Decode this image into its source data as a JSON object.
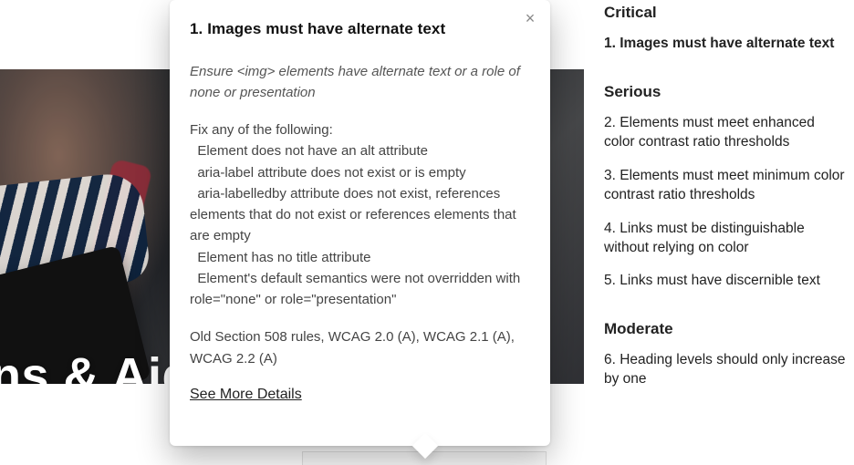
{
  "hero": {
    "headline_fragment": "ns & Aid"
  },
  "popup": {
    "title": "1. Images must have alternate text",
    "description": "Ensure <img> elements have alternate text or a role of none or presentation",
    "fix_text": "Fix any of the following:\n  Element does not have an alt attribute\n  aria-label attribute does not exist or is empty\n  aria-labelledby attribute does not exist, references elements that do not exist or references elements that are empty\n  Element has no title attribute\n  Element's default semantics were not overridden with role=\"none\" or role=\"presentation\"",
    "standards": "Old Section 508 rules, WCAG 2.0 (A), WCAG 2.1 (A), WCAG 2.2 (A)",
    "see_more_label": "See More Details",
    "close_label": "×"
  },
  "sidebar": {
    "sections": {
      "critical": {
        "label": "Critical",
        "items": {
          "i1": "1. Images must have alternate text"
        }
      },
      "serious": {
        "label": "Serious",
        "items": {
          "i2": "2. Elements must meet enhanced color contrast ratio thresholds",
          "i3": "3. Elements must meet minimum color contrast ratio thresholds",
          "i4": "4. Links must be distinguishable without relying on color",
          "i5": "5. Links must have discernible text"
        }
      },
      "moderate": {
        "label": "Moderate",
        "items": {
          "i6": "6. Heading levels should only increase by one"
        }
      }
    }
  }
}
